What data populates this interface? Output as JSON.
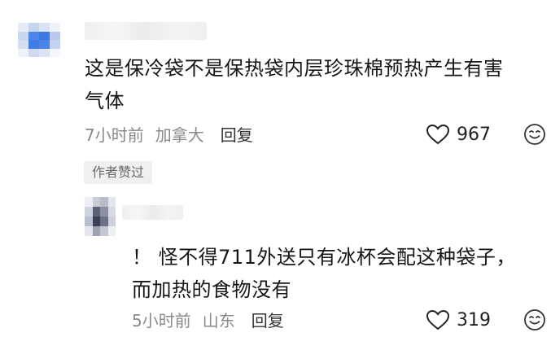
{
  "comments": [
    {
      "text_line1": "这是保冷袋不是保热袋内层珍珠棉预热产生有害",
      "text_line2": "气体",
      "time": "7小时前",
      "location": "加拿大",
      "reply_label": "回复",
      "likes": "967"
    },
    {
      "text_line1": "！ 怪不得711外送只有冰杯会配这种袋子，",
      "text_line2": "而加热的食物没有",
      "time": "5小时前",
      "location": "山东",
      "reply_label": "回复",
      "likes": "319"
    }
  ],
  "author_liked_badge": "作者赞过",
  "icons": {
    "like": "heart-outline-icon",
    "emoji": "smiley-face-icon"
  },
  "colors": {
    "text": "#151515",
    "meta": "#8a8a8a",
    "badge_bg": "#f0f0f0"
  }
}
